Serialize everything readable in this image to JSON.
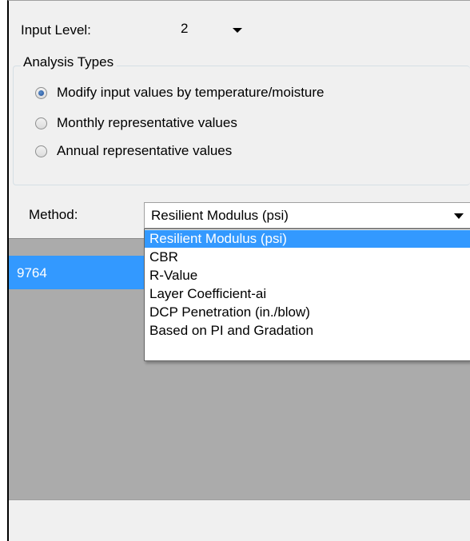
{
  "input_level": {
    "label": "Input Level:",
    "value": "2"
  },
  "analysis_types": {
    "legend": "Analysis Types",
    "options": [
      {
        "label": "Modify input values by temperature/moisture",
        "checked": true
      },
      {
        "label": "Monthly representative values",
        "checked": false
      },
      {
        "label": "Annual representative values",
        "checked": false
      }
    ]
  },
  "method": {
    "label": "Method:",
    "selected": "Resilient Modulus (psi)",
    "options": [
      "Resilient Modulus (psi)",
      "CBR",
      "R-Value",
      "Layer Coefficient-ai",
      "DCP Penetration (in./blow)",
      "Based on PI and Gradation"
    ],
    "highlighted_index": 0
  },
  "grid": {
    "rows": [
      "9764"
    ]
  },
  "colors": {
    "selection": "#3399ff",
    "panel": "#f0f0f0",
    "grid_background": "#ababab"
  }
}
